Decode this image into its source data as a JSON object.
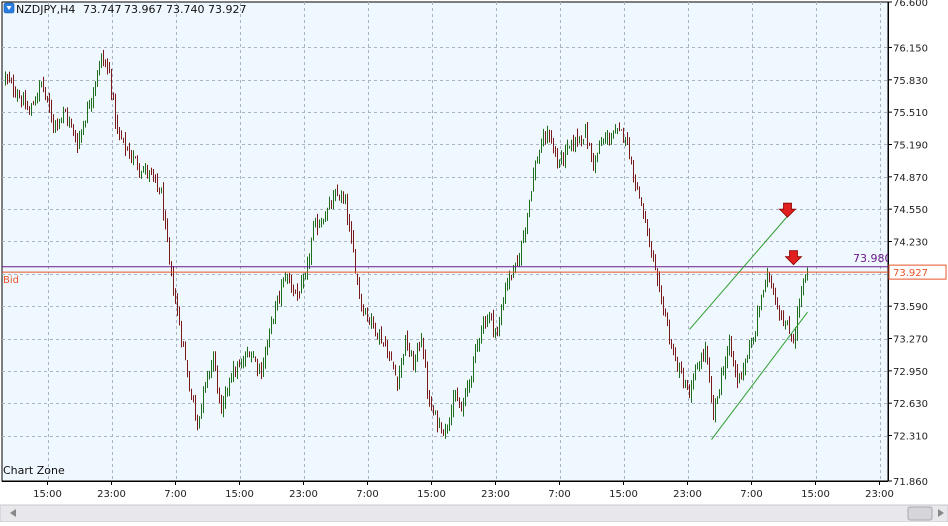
{
  "header": {
    "symbol": "NZDJPY,H4",
    "open": "73.747",
    "high": "73.967",
    "low": "73.740",
    "close": "73.927",
    "collapse_icon": "down-arrow-icon"
  },
  "watermark": "Chart Zone",
  "bid_label": "Bid",
  "colors": {
    "background": "#f0f8ff",
    "grid": "#aab4c0",
    "bull": "#1f6e1f",
    "bear": "#7a1a1a",
    "bid": "#e8532b",
    "channel": "#2f9e2f",
    "signal_arrow": "#e02020",
    "level_line": "#6a1a8a"
  },
  "chart_data": {
    "type": "candlestick",
    "symbol": "NZDJPY",
    "timeframe": "H4",
    "y_ticks": [
      "76.600",
      "76.150",
      "75.830",
      "75.510",
      "75.190",
      "74.870",
      "74.550",
      "74.230",
      "73.910",
      "73.590",
      "73.270",
      "72.950",
      "72.630",
      "72.310",
      "71.860"
    ],
    "ylim": [
      71.86,
      76.6
    ],
    "x_ticks": [
      "15:00",
      "23:00",
      "7:00",
      "15:00",
      "23:00",
      "7:00",
      "15:00",
      "23:00",
      "7:00",
      "15:00",
      "23:00",
      "7:00",
      "15:00",
      "23:00"
    ],
    "bid_price": "73.927",
    "bid_value": 73.927,
    "level_price": "73.980",
    "level_value": 73.98,
    "anchor_closes": [
      [
        0,
        75.85
      ],
      [
        6,
        75.7
      ],
      [
        12,
        75.5
      ],
      [
        18,
        75.8
      ],
      [
        24,
        75.4
      ],
      [
        30,
        75.5
      ],
      [
        36,
        75.2
      ],
      [
        42,
        75.6
      ],
      [
        48,
        76.05
      ],
      [
        52,
        75.9
      ],
      [
        56,
        75.3
      ],
      [
        62,
        75.1
      ],
      [
        68,
        74.95
      ],
      [
        72,
        74.9
      ],
      [
        78,
        74.7
      ],
      [
        82,
        74.0
      ],
      [
        88,
        73.3
      ],
      [
        92,
        72.8
      ],
      [
        96,
        72.45
      ],
      [
        100,
        72.8
      ],
      [
        104,
        73.1
      ],
      [
        108,
        72.5
      ],
      [
        112,
        72.9
      ],
      [
        118,
        73.0
      ],
      [
        122,
        73.15
      ],
      [
        128,
        72.95
      ],
      [
        134,
        73.5
      ],
      [
        140,
        73.9
      ],
      [
        146,
        73.7
      ],
      [
        150,
        73.85
      ],
      [
        154,
        74.35
      ],
      [
        160,
        74.5
      ],
      [
        166,
        74.7
      ],
      [
        170,
        74.6
      ],
      [
        174,
        74.1
      ],
      [
        178,
        73.6
      ],
      [
        184,
        73.4
      ],
      [
        190,
        73.2
      ],
      [
        196,
        72.85
      ],
      [
        200,
        73.25
      ],
      [
        204,
        73.0
      ],
      [
        208,
        73.3
      ],
      [
        212,
        72.6
      ],
      [
        216,
        72.45
      ],
      [
        220,
        72.35
      ],
      [
        224,
        72.7
      ],
      [
        228,
        72.55
      ],
      [
        232,
        72.85
      ],
      [
        238,
        73.4
      ],
      [
        242,
        73.5
      ],
      [
        246,
        73.3
      ],
      [
        250,
        73.8
      ],
      [
        256,
        74.0
      ],
      [
        260,
        74.4
      ],
      [
        264,
        74.9
      ],
      [
        268,
        75.2
      ],
      [
        272,
        75.3
      ],
      [
        276,
        75.0
      ],
      [
        280,
        75.1
      ],
      [
        286,
        75.25
      ],
      [
        290,
        75.3
      ],
      [
        294,
        75.0
      ],
      [
        298,
        75.2
      ],
      [
        304,
        75.3
      ],
      [
        310,
        75.3
      ],
      [
        314,
        74.9
      ],
      [
        318,
        74.6
      ],
      [
        322,
        74.2
      ],
      [
        326,
        73.8
      ],
      [
        330,
        73.5
      ],
      [
        334,
        73.1
      ],
      [
        338,
        72.9
      ],
      [
        342,
        72.7
      ],
      [
        346,
        73.0
      ],
      [
        350,
        73.15
      ],
      [
        354,
        72.5
      ],
      [
        358,
        72.9
      ],
      [
        362,
        73.2
      ],
      [
        366,
        72.85
      ],
      [
        370,
        73.05
      ],
      [
        374,
        73.25
      ],
      [
        378,
        73.7
      ],
      [
        382,
        73.9
      ],
      [
        386,
        73.6
      ],
      [
        390,
        73.4
      ],
      [
        394,
        73.25
      ],
      [
        398,
        73.75
      ],
      [
        401,
        73.927
      ]
    ],
    "candle_count": 402,
    "x_tick_candle_index": [
      21,
      53,
      85,
      117,
      149,
      181,
      213,
      245,
      277,
      309,
      341,
      373,
      405,
      437
    ],
    "channel_upper": [
      [
        342,
        73.36
      ],
      [
        391,
        74.48
      ]
    ],
    "channel_lower": [
      [
        353,
        72.27
      ],
      [
        401,
        73.53
      ]
    ],
    "sell_arrows": [
      [
        391,
        74.53
      ],
      [
        394,
        74.06
      ]
    ]
  }
}
